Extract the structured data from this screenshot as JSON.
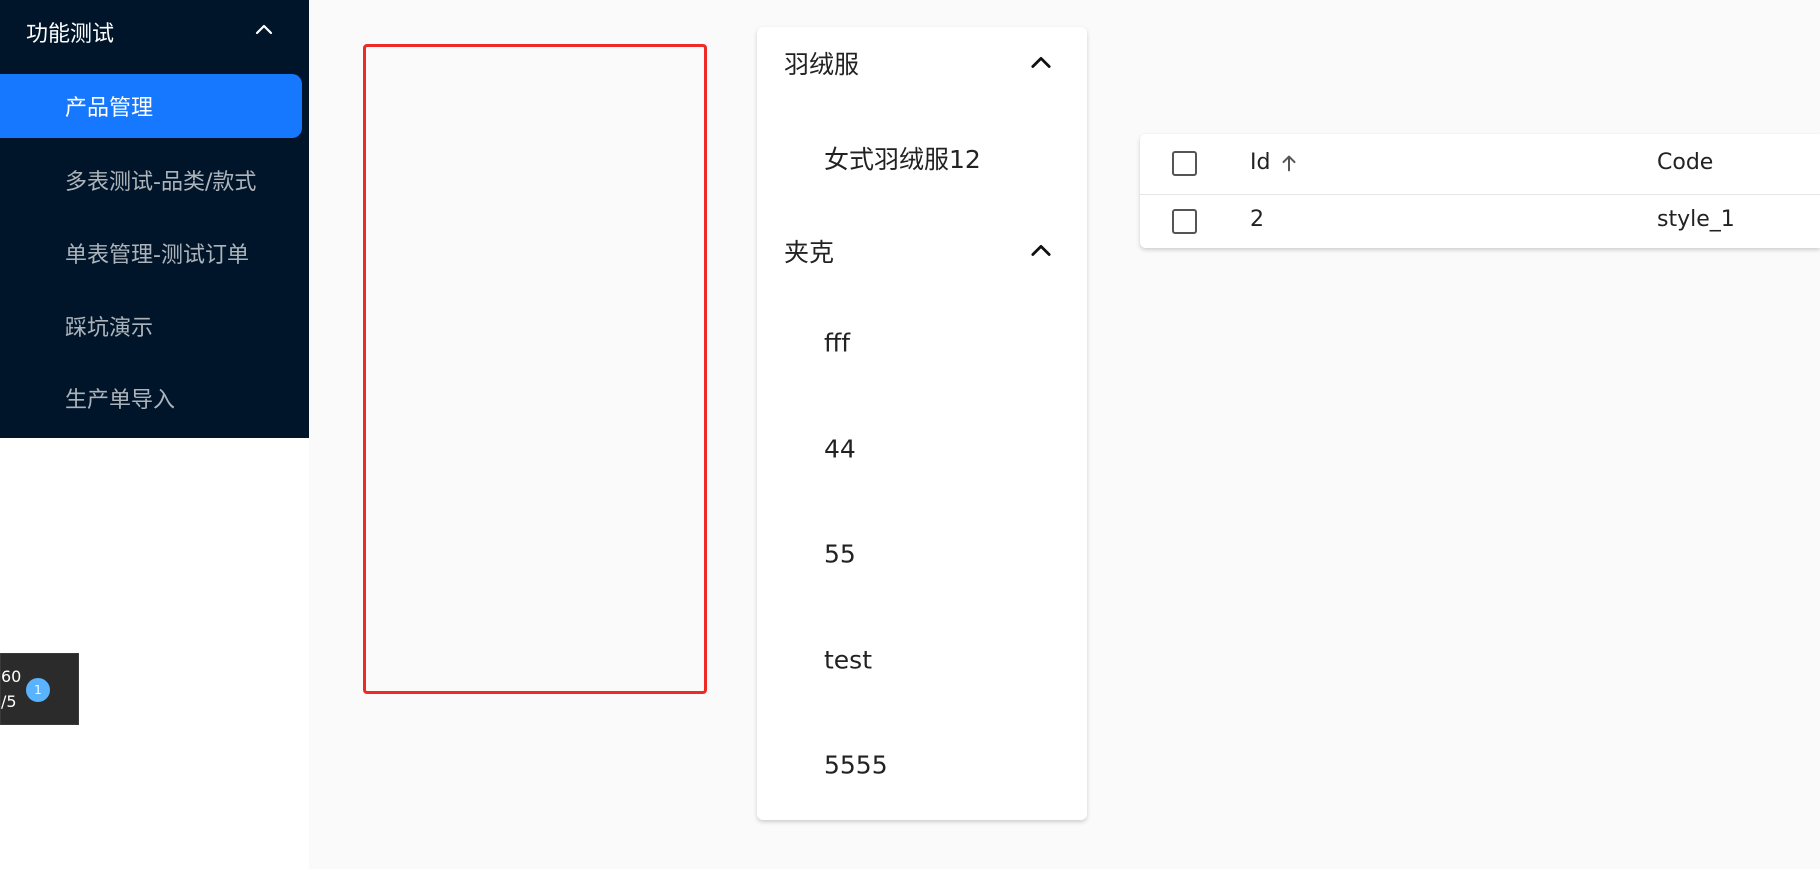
{
  "sidebar": {
    "group_title": "功能测试",
    "items": [
      {
        "label": "产品管理",
        "active": true
      },
      {
        "label": "多表测试-品类/款式",
        "active": false
      },
      {
        "label": "单表管理-测试订单",
        "active": false
      },
      {
        "label": "踩坑演示",
        "active": false
      },
      {
        "label": "生产单导入",
        "active": false
      }
    ]
  },
  "widget": {
    "line1": "60",
    "line2": "/5",
    "badge": "1"
  },
  "categories": [
    {
      "title": "羽绒服",
      "items": [
        "女式羽绒服12"
      ]
    },
    {
      "title": "夹克",
      "items": [
        "fff",
        "44",
        "55",
        "test",
        "5555"
      ]
    }
  ],
  "table": {
    "columns": {
      "id": "Id",
      "code": "Code"
    },
    "rows": [
      {
        "id": "2",
        "code": "style_1"
      }
    ]
  },
  "colors": {
    "sidebar_bg": "#001529",
    "active_item": "#1677ff",
    "highlight_border": "#ee2a24",
    "badge": "#5ab3ff"
  },
  "icons": {
    "group_caret": "chevron-up-icon",
    "category_caret": "chevron-up-icon",
    "sort": "arrow-up-icon",
    "checkbox": "checkbox-icon"
  }
}
